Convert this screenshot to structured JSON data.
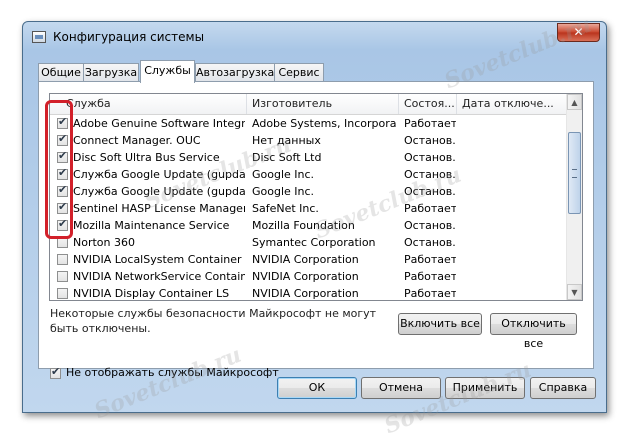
{
  "window": {
    "title": "Конфигурация системы",
    "close_label": "✕",
    "tabs": [
      {
        "label": "Общие",
        "active": false
      },
      {
        "label": "Загрузка",
        "active": false
      },
      {
        "label": "Службы",
        "active": true
      },
      {
        "label": "Автозагрузка",
        "active": false
      },
      {
        "label": "Сервис",
        "active": false
      }
    ]
  },
  "services": {
    "columns": [
      "Служба",
      "Изготовитель",
      "Состоя...",
      "Дата отключе..."
    ],
    "rows": [
      {
        "name": "Adobe Genuine Software Integri...",
        "vendor": "Adobe Systems, Incorpora...",
        "status": "Работает",
        "checked": true
      },
      {
        "name": "Connect Manager. OUC",
        "vendor": "Нет данных",
        "status": "Останов...",
        "checked": true
      },
      {
        "name": "Disc Soft Ultra Bus Service",
        "vendor": "Disc Soft Ltd",
        "status": "Останов...",
        "checked": true
      },
      {
        "name": "Служба Google Update (gupdate)",
        "vendor": "Google Inc.",
        "status": "Останов...",
        "checked": true
      },
      {
        "name": "Служба Google Update (gupdate...",
        "vendor": "Google Inc.",
        "status": "Останов...",
        "checked": true
      },
      {
        "name": "Sentinel HASP License Manager",
        "vendor": "SafeNet Inc.",
        "status": "Работает",
        "checked": true
      },
      {
        "name": "Mozilla Maintenance Service",
        "vendor": "Mozilla Foundation",
        "status": "Останов...",
        "checked": true
      },
      {
        "name": "Norton 360",
        "vendor": "Symantec Corporation",
        "status": "Останов...",
        "checked": false
      },
      {
        "name": "NVIDIA LocalSystem Container",
        "vendor": "NVIDIA Corporation",
        "status": "Работает",
        "checked": false
      },
      {
        "name": "NVIDIA NetworkService Container",
        "vendor": "NVIDIA Corporation",
        "status": "Работает",
        "checked": false
      },
      {
        "name": "NVIDIA Display Container LS",
        "vendor": "NVIDIA Corporation",
        "status": "Работает",
        "checked": false
      }
    ],
    "notice": "Некоторые службы безопасности Майкрософт не могут быть отключены.",
    "enable_all": "Включить все",
    "disable_all": "Отключить все",
    "hide_ms_label": "Не отображать службы Майкрософт",
    "hide_ms_checked": true
  },
  "footer": {
    "ok": "ОК",
    "cancel": "Отмена",
    "apply": "Применить",
    "help": "Справка"
  },
  "watermark": "Sovetclub.ru",
  "colors": {
    "highlight": "#d2202a",
    "window_frame": "#a9c6e6"
  }
}
